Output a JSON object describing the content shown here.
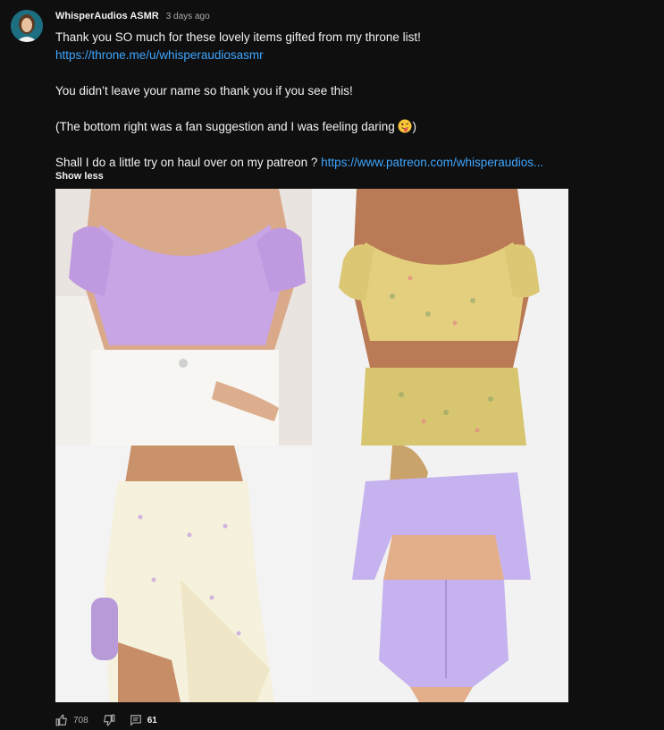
{
  "comment": {
    "author": "WhisperAudios ASMR",
    "time": "3 days ago",
    "line1": "Thank you SO much for these lovely items gifted from my throne list!",
    "link1": "https://throne.me/u/whisperaudiosasmr",
    "line2": "You didn’t leave your name so thank you if you see this!",
    "line3_text": "(The bottom right was a fan suggestion and I was feeling daring ",
    "line3_close": ")",
    "line4_text": "Shall I do a little try on haul over on my patreon ? ",
    "link2": "https://www.patreon.com/whisperaudios...",
    "show_less": "Show less"
  },
  "images": [
    {
      "name": "lilac-twist-crop-top",
      "color": "#c8a6e6"
    },
    {
      "name": "yellow-floral-crop-set",
      "color": "#e3cf7d"
    },
    {
      "name": "cream-floral-tie-dress",
      "color": "#f6f1dc"
    },
    {
      "name": "lilac-ruched-two-piece",
      "color": "#c5b2ef"
    }
  ],
  "actions": {
    "likes": "708",
    "replies": "61"
  },
  "colors": {
    "background": "#0f0f0f",
    "link": "#3ea6ff",
    "muted": "#aaaaaa",
    "text": "#f1f1f1"
  }
}
